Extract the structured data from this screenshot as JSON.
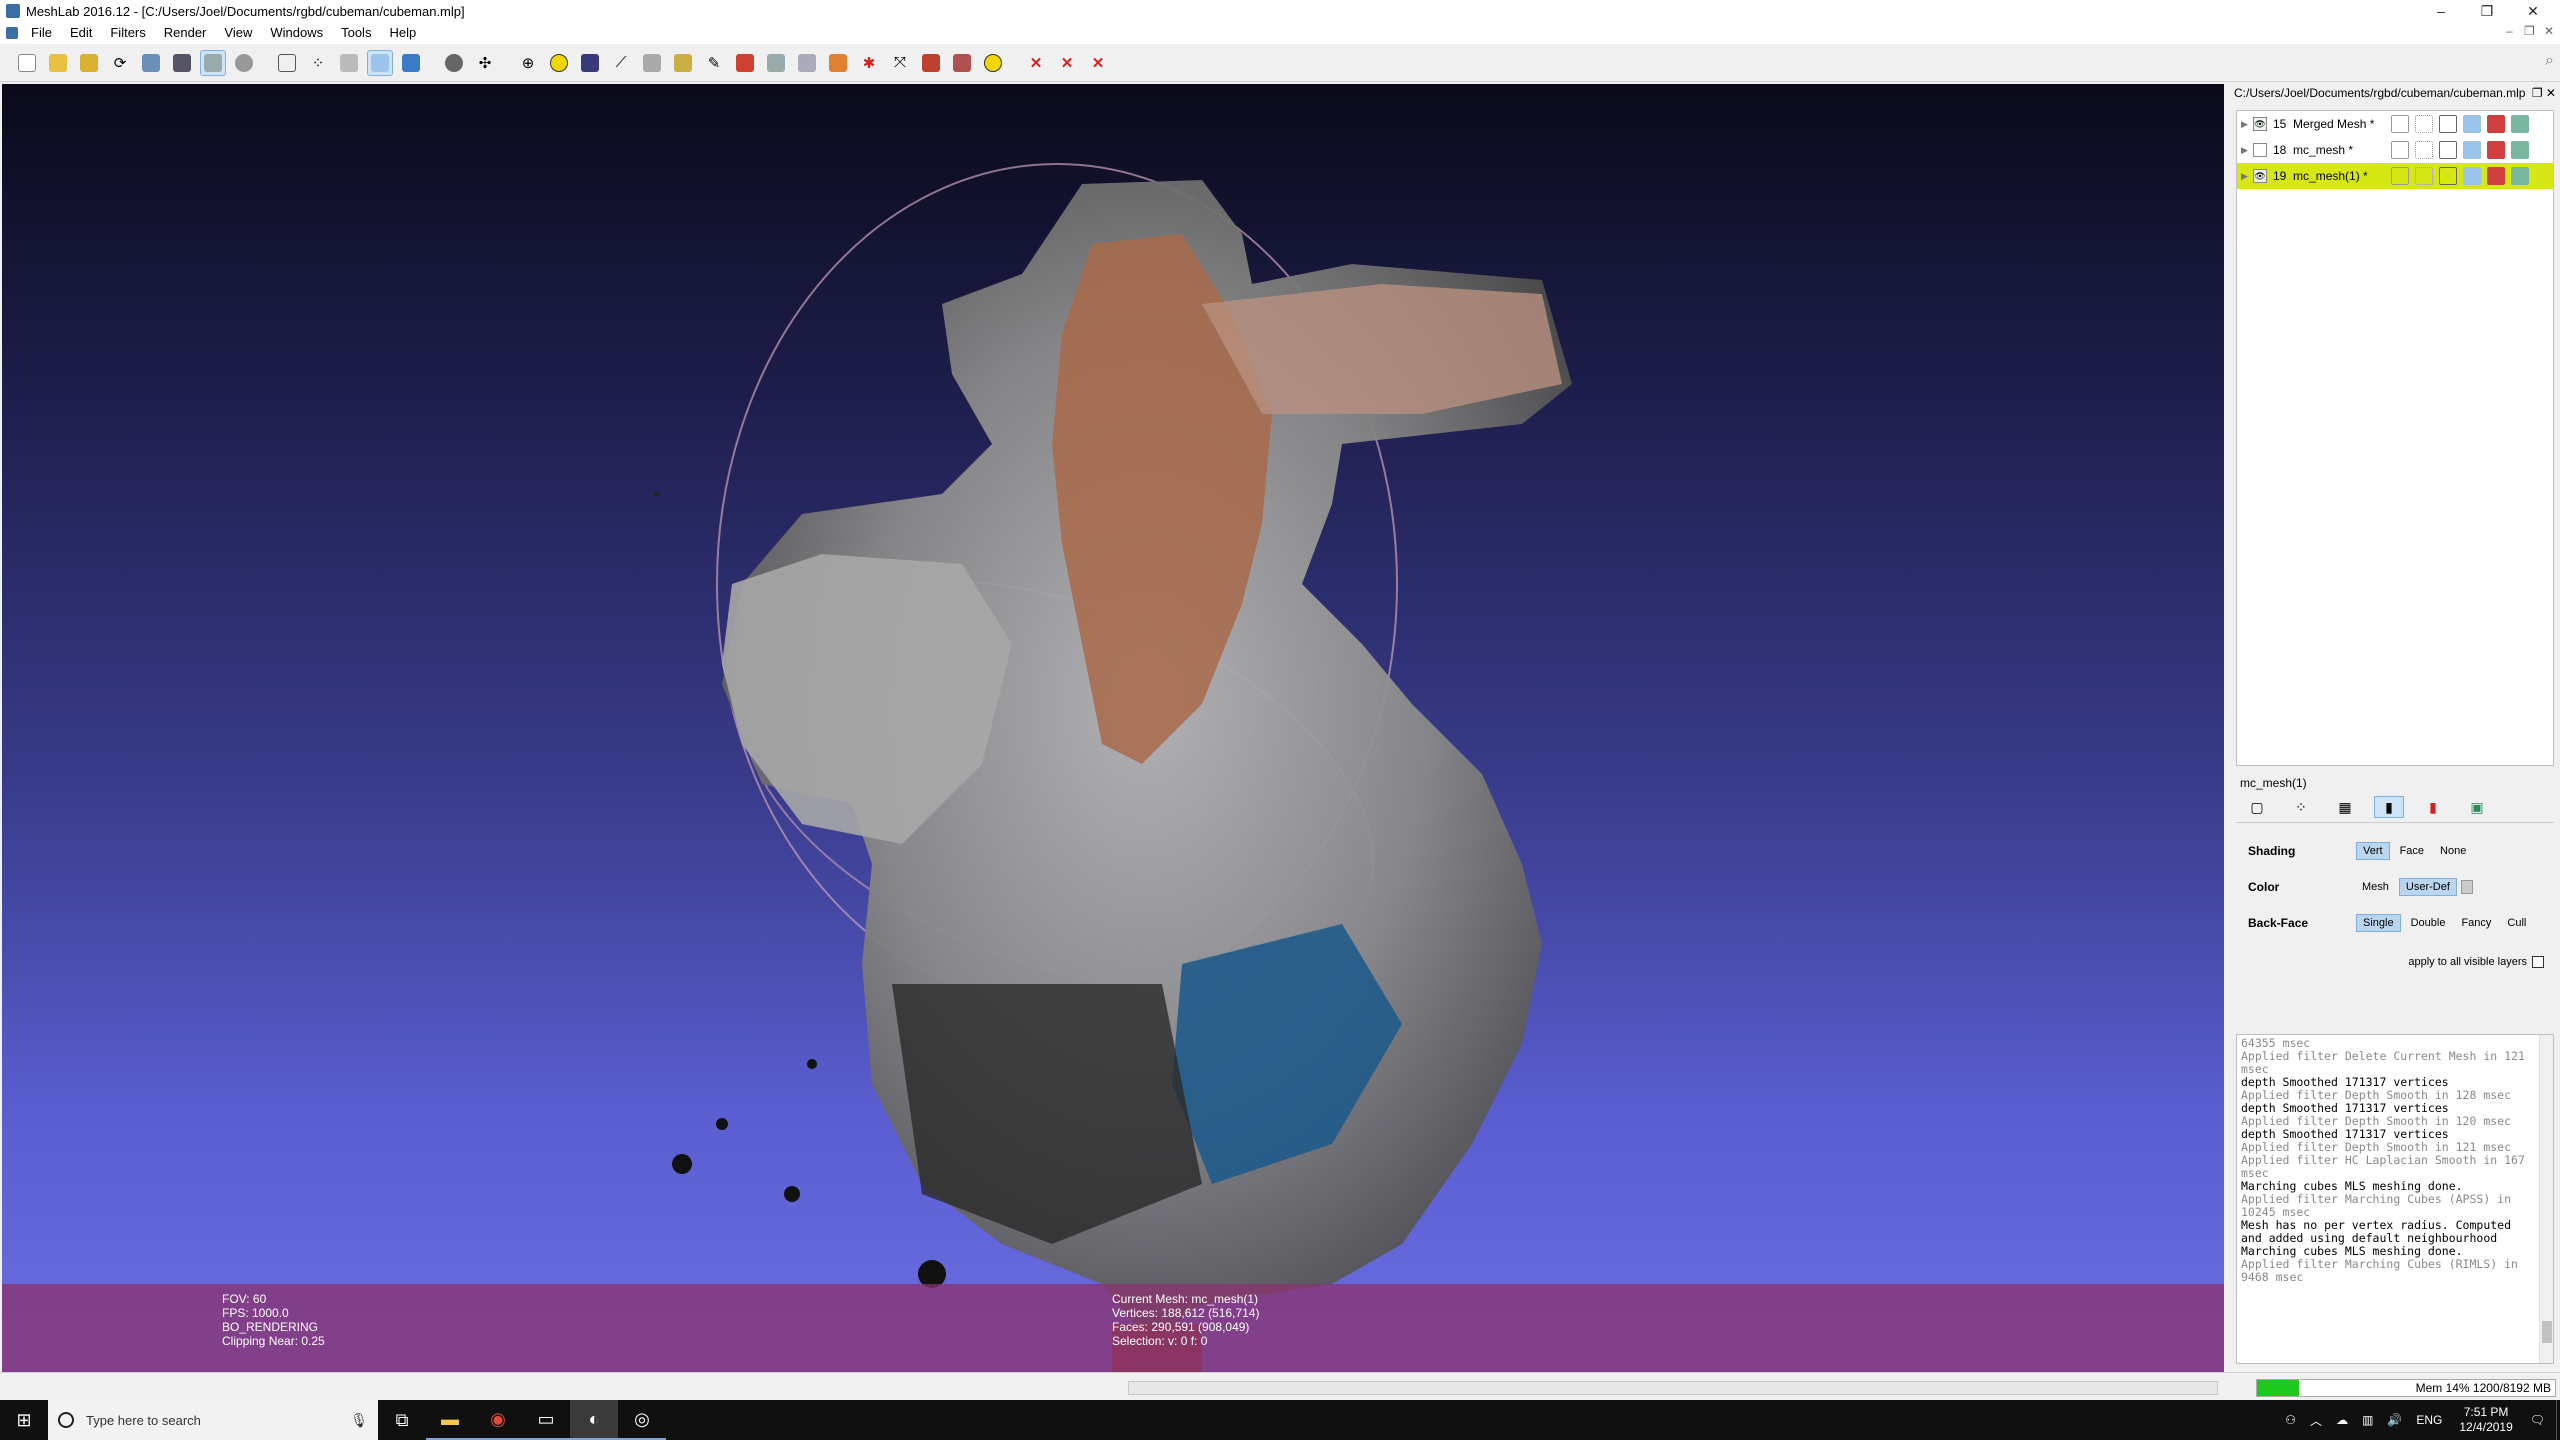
{
  "window": {
    "title": "MeshLab 2016.12 - [C:/Users/Joel/Documents/rgbd/cubeman/cubeman.mlp]",
    "min": "–",
    "max": "❐",
    "close": "✕"
  },
  "menu": [
    "File",
    "Edit",
    "Filters",
    "Render",
    "View",
    "Windows",
    "Tools",
    "Help"
  ],
  "toolbar": {
    "icons": [
      "new-project-icon",
      "open-project-icon",
      "import-mesh-icon",
      "reload-icon",
      "export-mesh-icon",
      "snapshot-icon",
      "render-bbox-icon",
      "render-points-icon",
      "render-wireframe-icon",
      "render-flat-icon",
      "render-smooth-icon",
      "light-icon",
      "background-icon",
      "manipulator-icon",
      "align-icon",
      "measure-icon",
      "pick-points-icon",
      "select-faces-icon",
      "paint-icon",
      "texture-icon",
      "select-vertices-icon",
      "colorize-icon",
      "z-paint-icon",
      "qualitymapper-icon",
      "info-icon",
      "delete-faces-icon",
      "delete-vertices-icon",
      "delete-all-icon"
    ],
    "accent_blue": "#3a7cc7",
    "accent_red": "#d62020",
    "accent_yellow": "#f2d600"
  },
  "hud": {
    "left": [
      "FOV: 60",
      "FPS:  1000.0",
      "BO_RENDERING",
      "Clipping Near:   0.25"
    ],
    "center": [
      "Current Mesh: mc_mesh(1)",
      "Vertices: 188,612    (516,714)",
      "Faces: 290,591    (908,049)",
      "Selection: v: 0 f: 0"
    ]
  },
  "layers_panel": {
    "path": "C:/Users/Joel/Documents/rgbd/cubeman/cubeman.mlp",
    "layers": [
      {
        "id": "15",
        "name": "Merged Mesh *",
        "visible": true,
        "selected": false
      },
      {
        "id": "18",
        "name": "mc_mesh *",
        "visible": false,
        "selected": false
      },
      {
        "id": "19",
        "name": "mc_mesh(1) *",
        "visible": true,
        "selected": true
      }
    ]
  },
  "props": {
    "title": "mc_mesh(1)",
    "shading_label": "Shading",
    "shading_opts": [
      "Vert",
      "Face",
      "None"
    ],
    "color_label": "Color",
    "color_opts": [
      "Mesh",
      "User-Def"
    ],
    "backface_label": "Back-Face",
    "backface_opts": [
      "Single",
      "Double",
      "Fancy",
      "Cull"
    ],
    "apply_all": "apply to all visible layers"
  },
  "log": [
    {
      "t": "64355 msec",
      "g": true
    },
    {
      "t": "Applied filter Delete Current Mesh in 121 msec",
      "g": true
    },
    {
      "t": "depth Smoothed 171317 vertices",
      "g": false
    },
    {
      "t": "Applied filter Depth Smooth in 128 msec",
      "g": true
    },
    {
      "t": "depth Smoothed 171317 vertices",
      "g": false
    },
    {
      "t": "Applied filter Depth Smooth in 120 msec",
      "g": true
    },
    {
      "t": "depth Smoothed 171317 vertices",
      "g": false
    },
    {
      "t": "Applied filter Depth Smooth in 121 msec",
      "g": true
    },
    {
      "t": "Applied filter HC Laplacian Smooth in 167 msec",
      "g": true
    },
    {
      "t": "Marching cubes MLS meshing done.",
      "g": false
    },
    {
      "t": "Applied filter Marching Cubes (APSS) in 10245 msec",
      "g": true
    },
    {
      "t": "Mesh has no per vertex radius. Computed and added using default neighbourhood",
      "g": false
    },
    {
      "t": "Marching cubes MLS meshing done.",
      "g": false
    },
    {
      "t": "Applied filter Marching Cubes (RIMLS) in 9468 msec",
      "g": true
    }
  ],
  "status": {
    "mem": "Mem 14% 1200/8192 MB",
    "mem_fraction": 0.14
  },
  "taskbar": {
    "search_placeholder": "Type here to search",
    "lang": "ENG",
    "time": "7:51 PM",
    "date": "12/4/2019"
  }
}
